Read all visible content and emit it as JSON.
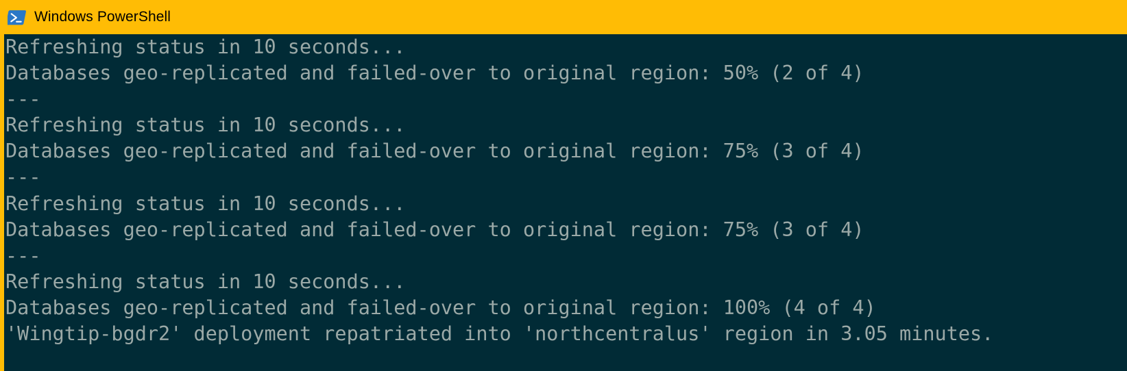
{
  "window": {
    "title": "Windows PowerShell",
    "icon": "powershell-icon",
    "titlebar_color": "#ffbc05",
    "titlebar_text_color": "#000000",
    "accent_border_color": "#ffbc05"
  },
  "terminal": {
    "background_color": "#012b36",
    "foreground_color": "#9ba9a7",
    "lines": [
      "Refreshing status in 10 seconds...",
      "Databases geo-replicated and failed-over to original region: 50% (2 of 4)",
      "---",
      "Refreshing status in 10 seconds...",
      "Databases geo-replicated and failed-over to original region: 75% (3 of 4)",
      "---",
      "Refreshing status in 10 seconds...",
      "Databases geo-replicated and failed-over to original region: 75% (3 of 4)",
      "---",
      "Refreshing status in 10 seconds...",
      "Databases geo-replicated and failed-over to original region: 100% (4 of 4)",
      "'Wingtip-bgdr2' deployment repatriated into 'northcentralus' region in 3.05 minutes."
    ]
  }
}
